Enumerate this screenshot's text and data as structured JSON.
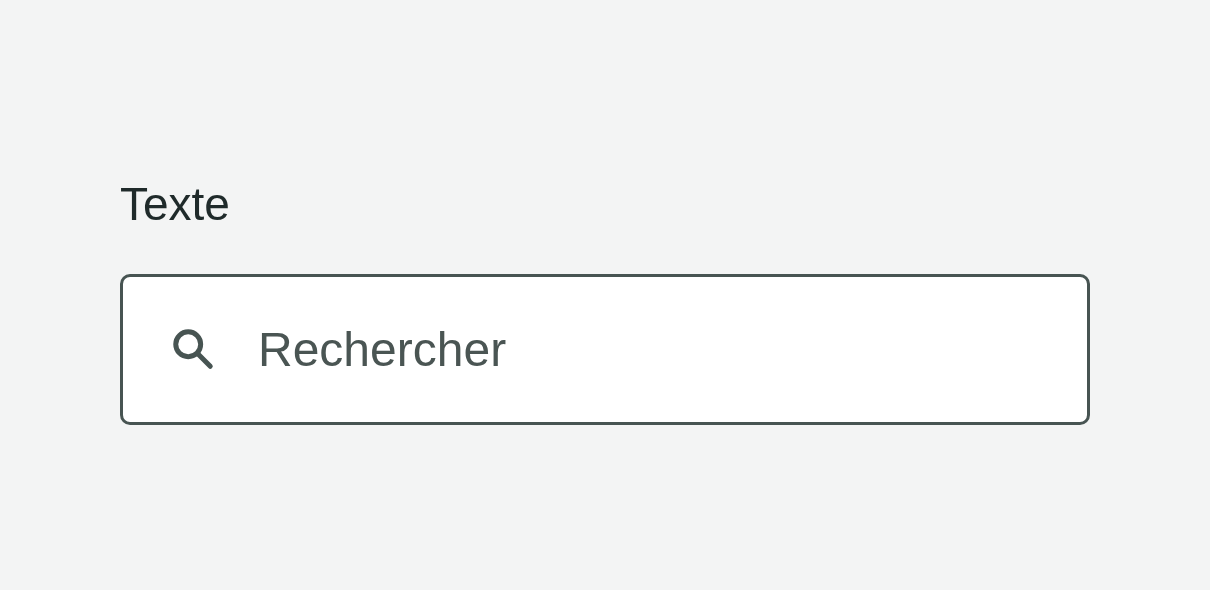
{
  "label": "Texte",
  "search": {
    "placeholder": "Rechercher"
  }
}
